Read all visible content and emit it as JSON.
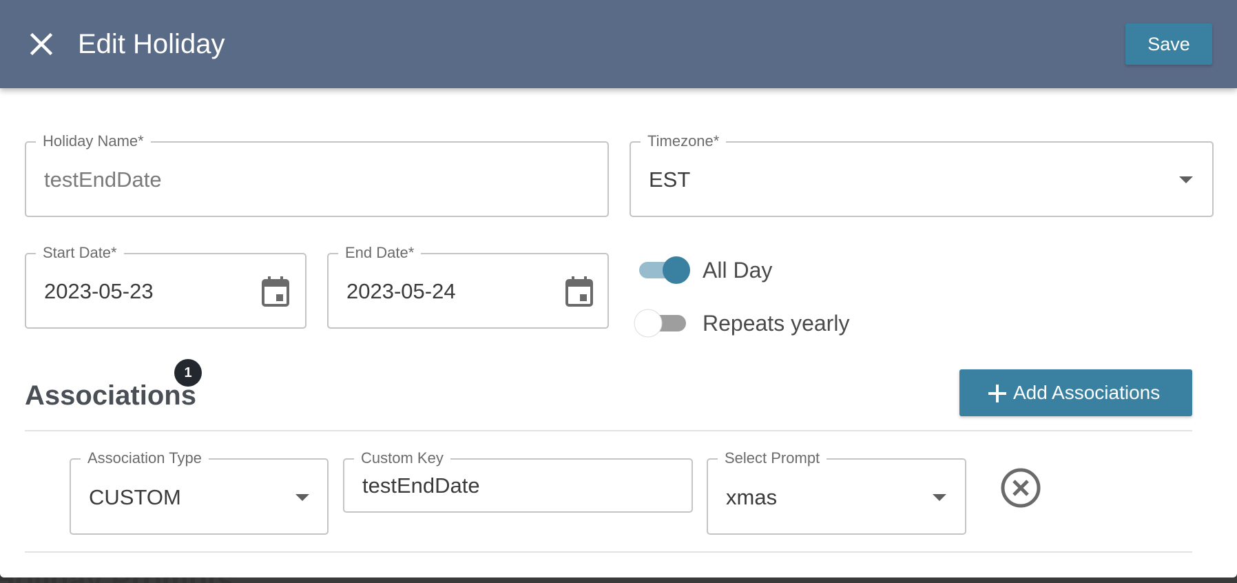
{
  "header": {
    "title": "Edit Holiday",
    "save_label": "Save",
    "background_color": "#5a6b87",
    "accent_color": "#3a80a0"
  },
  "form": {
    "holiday_name": {
      "label": "Holiday Name*",
      "value": "testEndDate"
    },
    "timezone": {
      "label": "Timezone*",
      "value": "EST"
    },
    "start_date": {
      "label": "Start Date*",
      "value": "2023-05-23"
    },
    "end_date": {
      "label": "End Date*",
      "value": "2023-05-24"
    },
    "all_day": {
      "label": "All Day",
      "checked": true
    },
    "repeats_yearly": {
      "label": "Repeats yearly",
      "checked": false
    }
  },
  "associations": {
    "title": "Associations",
    "badge_count": "1",
    "add_label": "Add Associations",
    "rows": [
      {
        "type_label": "Association Type",
        "type_value": "CUSTOM",
        "key_label": "Custom Key",
        "key_value": "testEndDate",
        "prompt_label": "Select Prompt",
        "prompt_value": "xmas"
      }
    ]
  },
  "background_page": {
    "partial_heading": "Holiday Prompts"
  }
}
